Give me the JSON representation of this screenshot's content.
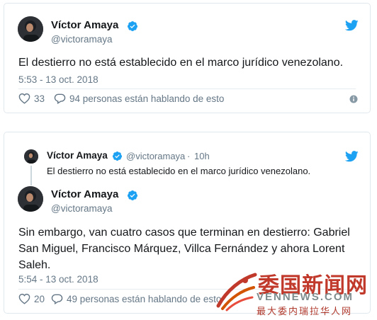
{
  "tweet1": {
    "name": "Víctor Amaya",
    "handle": "@victoramaya",
    "text": "El destierro no está establecido en el marco jurídico venezolano.",
    "timestamp": "5:53 - 13 oct. 2018",
    "likes": "33",
    "talking": "94 personas están hablando de esto"
  },
  "tweet2": {
    "parent": {
      "name": "Víctor Amaya",
      "handle": "@victoramaya",
      "age": "10h",
      "text": "El destierro no está establecido en el marco jurídico venezolano."
    },
    "name": "Víctor Amaya",
    "handle": "@victoramaya",
    "text_lines": [
      "Sin embargo, van cuatro casos que terminan en destierro: Gabriel",
      "San Miguel, Francisco Márquez, Villca Fernández y ahora Lorent",
      "Saleh."
    ],
    "timestamp": "5:54 - 13 oct. 2018",
    "likes": "20",
    "talking": "49 personas están hablando de esto"
  },
  "watermark": {
    "title": "委国新闻网",
    "url": "VENNEWS.COM",
    "tagline": "最大委内瑞拉华人网"
  },
  "icons": {
    "verified": "verified-badge-icon",
    "bird": "twitter-bird-icon",
    "like": "heart-icon",
    "reply": "speech-bubble-icon",
    "info": "info-icon"
  },
  "colors": {
    "twitter_blue": "#1da1f2",
    "text": "#14171a",
    "muted": "#657786",
    "border": "#e1e8ed"
  }
}
